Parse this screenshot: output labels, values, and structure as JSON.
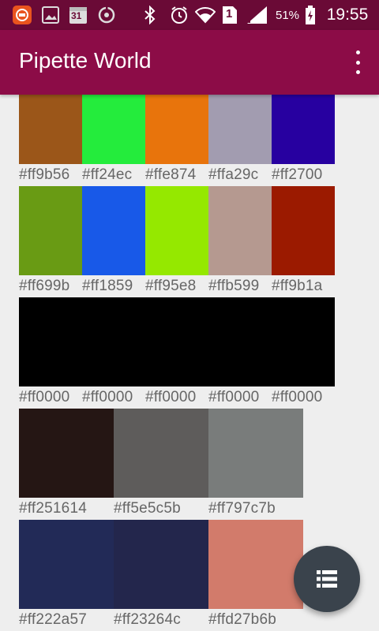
{
  "status_bar": {
    "battery_percent": "51%",
    "time": "19:55",
    "sim_slot": "1",
    "calendar_day": "31",
    "icons": [
      "app-notification-icon",
      "image-icon",
      "calendar-icon",
      "sync-icon",
      "bluetooth-icon",
      "alarm-icon",
      "wifi-icon",
      "sim-icon",
      "signal-icon",
      "battery-icon"
    ]
  },
  "app_bar": {
    "title": "Pipette World",
    "overflow_icon": "more-vert-icon"
  },
  "palettes": [
    {
      "swatches": [
        {
          "color": "#9b5619",
          "label": "#ff9b56"
        },
        {
          "color": "#24ec3c",
          "label": "#ff24ec"
        },
        {
          "color": "#e8740c",
          "label": "#ffe874"
        },
        {
          "color": "#a29cb0",
          "label": "#ffa29c"
        },
        {
          "color": "#2700a0",
          "label": "#ff2700"
        }
      ]
    },
    {
      "swatches": [
        {
          "color": "#699b14",
          "label": "#ff699b"
        },
        {
          "color": "#1859e8",
          "label": "#ff1859"
        },
        {
          "color": "#95e800",
          "label": "#ff95e8"
        },
        {
          "color": "#b59990",
          "label": "#ffb599"
        },
        {
          "color": "#9b1a00",
          "label": "#ff9b1a"
        }
      ]
    },
    {
      "swatches": [
        {
          "color": "#000000",
          "label": "#ff0000"
        },
        {
          "color": "#000000",
          "label": "#ff0000"
        },
        {
          "color": "#000000",
          "label": "#ff0000"
        },
        {
          "color": "#000000",
          "label": "#ff0000"
        },
        {
          "color": "#000000",
          "label": "#ff0000"
        }
      ]
    },
    {
      "swatches": [
        {
          "color": "#251614",
          "label": "#ff251614"
        },
        {
          "color": "#5e5c5b",
          "label": "#ff5e5c5b"
        },
        {
          "color": "#797c7b",
          "label": "#ff797c7b"
        }
      ]
    },
    {
      "swatches": [
        {
          "color": "#222a57",
          "label": "#ff222a57"
        },
        {
          "color": "#23264c",
          "label": "#ff23264c"
        },
        {
          "color": "#d27b6b",
          "label": "#ffd27b6b"
        }
      ]
    }
  ],
  "fab": {
    "icon": "list-view-icon"
  },
  "colors": {
    "status_bar_bg": "#6a0a36",
    "app_bar_bg": "#8c0c47",
    "background": "#eeeeee",
    "label_text": "#666666",
    "fab_bg": "#3a434c"
  }
}
